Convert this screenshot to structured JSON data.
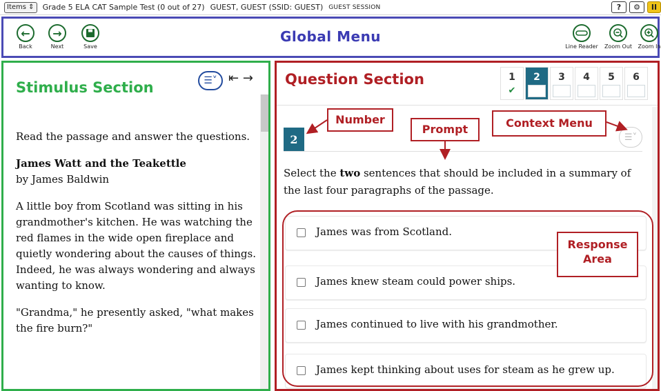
{
  "topbar": {
    "items_label": "Items",
    "test_title": "Grade 5 ELA CAT Sample Test (0 out of 27)",
    "guest_info": "GUEST, GUEST (SSID: GUEST)",
    "session": "GUEST SESSION",
    "help_label": "?",
    "settings_label": "⚙",
    "pause_label": "II"
  },
  "global_menu": {
    "title": "Global Menu",
    "back_label": "Back",
    "next_label": "Next",
    "save_label": "Save",
    "line_reader_label": "Line Reader",
    "zoom_out_label": "Zoom Out",
    "zoom_in_label": "Zoom In"
  },
  "stimulus": {
    "title": "Stimulus Section",
    "instructions": "Read the passage and answer the questions.",
    "passage_title": "James Watt and the Teakettle",
    "byline": "by James Baldwin",
    "paragraph1": "A little boy from Scotland was sitting in his grandmother's kitchen. He was watching the red flames in the wide open fireplace and quietly wondering about the causes of things. Indeed, he was always wondering and always wanting to know.",
    "paragraph2": "\"Grandma,\" he presently asked, \"what makes the fire burn?\""
  },
  "question": {
    "title": "Question Section",
    "pages": [
      {
        "label": "1",
        "answered": true
      },
      {
        "label": "2",
        "active": true
      },
      {
        "label": "3"
      },
      {
        "label": "4"
      },
      {
        "label": "5"
      },
      {
        "label": "6"
      }
    ],
    "number": "2",
    "prompt_before": "Select the ",
    "prompt_bold": "two",
    "prompt_after": " sentences that should be included in a summary of the last four paragraphs of the passage.",
    "options": [
      "James was from Scotland.",
      "James knew steam could power ships.",
      "James continued to live with his grandmother.",
      "James kept thinking about uses for steam as he grew up."
    ]
  },
  "annotations": {
    "number": "Number",
    "prompt": "Prompt",
    "context_menu": "Context Menu",
    "response_area_line1": "Response",
    "response_area_line2": "Area"
  },
  "colors": {
    "global_border": "#4a4ab5",
    "stimulus_border": "#2fae4b",
    "question_border": "#b01f24",
    "nav_green": "#1c6b2e",
    "active_page": "#1f6a84"
  }
}
